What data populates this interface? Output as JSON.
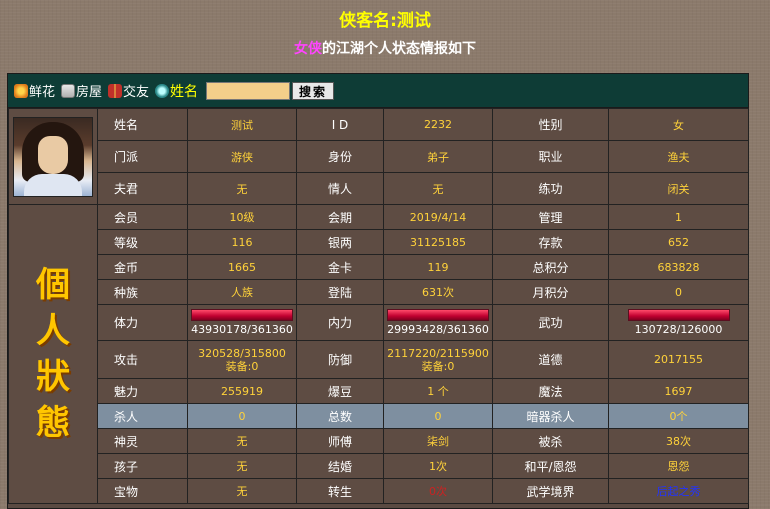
{
  "header": {
    "title": "侠客名:测试",
    "subtitle_gender": "女侠",
    "subtitle_rest": "的江湖个人状态情报如下"
  },
  "toolbar": {
    "flower": "鲜花",
    "house": "房屋",
    "friend": "交友",
    "name": "姓名",
    "search_value": "",
    "search_button": "搜索"
  },
  "status_banner": [
    "個",
    "人",
    "狀",
    "態"
  ],
  "rows": [
    [
      [
        "姓名",
        "测试"
      ],
      [
        "I D",
        "2232"
      ],
      [
        "性别",
        "女"
      ]
    ],
    [
      [
        "门派",
        "游侠"
      ],
      [
        "身份",
        "弟子"
      ],
      [
        "职业",
        "渔夫"
      ]
    ],
    [
      [
        "夫君",
        "无"
      ],
      [
        "情人",
        "无"
      ],
      [
        "练功",
        "闭关"
      ]
    ],
    [
      [
        "会员",
        "10级"
      ],
      [
        "会期",
        "2019/4/14"
      ],
      [
        "管理",
        "1"
      ]
    ],
    [
      [
        "等级",
        "116"
      ],
      [
        "银两",
        "31125185"
      ],
      [
        "存款",
        "652"
      ]
    ],
    [
      [
        "金币",
        "1665"
      ],
      [
        "金卡",
        "119"
      ],
      [
        "总积分",
        "683828"
      ]
    ],
    [
      [
        "种族",
        "人族"
      ],
      [
        "登陆",
        "631次"
      ],
      [
        "月积分",
        "0"
      ]
    ]
  ],
  "bars": {
    "hp": {
      "label": "体力",
      "text": "43930178/361360",
      "fill": 1.0
    },
    "mp": {
      "label": "内力",
      "text": "29993428/361360",
      "fill": 1.0
    },
    "wg": {
      "label": "武功",
      "text": "130728/126000",
      "fill": 1.0
    }
  },
  "attack": {
    "label": "攻击",
    "line1": "320528/315800",
    "line2": "装备:0"
  },
  "defense": {
    "label": "防御",
    "line1": "2117220/2115900",
    "line2": "装备:0"
  },
  "morality": {
    "label": "道德",
    "value": "2017155"
  },
  "rows2": [
    [
      [
        "魅力",
        "255919"
      ],
      [
        "爆豆",
        "1 个"
      ],
      [
        "魔法",
        "1697"
      ]
    ]
  ],
  "kill_row": [
    [
      "杀人",
      "0"
    ],
    [
      "总数",
      "0"
    ],
    [
      "暗器杀人",
      "0个"
    ]
  ],
  "rows3": [
    [
      [
        "神灵",
        "无"
      ],
      [
        "师傅",
        "柒剑"
      ],
      [
        "被杀",
        "38次"
      ]
    ],
    [
      [
        "孩子",
        "无"
      ],
      [
        "结婚",
        "1次"
      ],
      [
        "和平/恩怨",
        "恩怨"
      ]
    ]
  ],
  "last_row": [
    [
      "宝物",
      "无"
    ],
    [
      "转生",
      "0次"
    ],
    [
      "武学境界",
      "后起之秀"
    ]
  ]
}
